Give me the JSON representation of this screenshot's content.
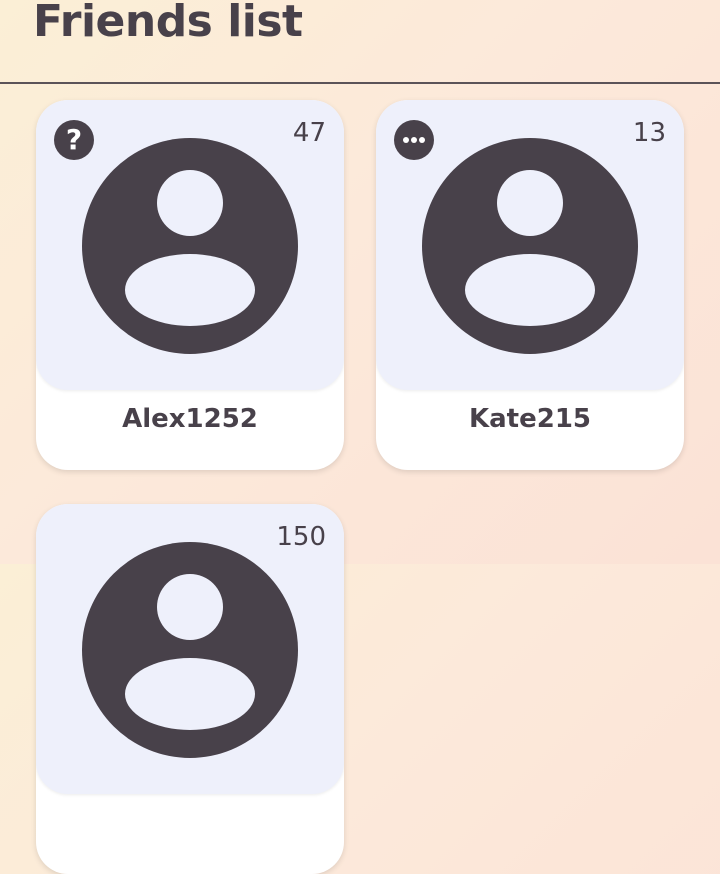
{
  "header": {
    "title": "Friends list"
  },
  "friends": [
    {
      "name": "Alex1252",
      "count": "47",
      "status_icon": "question-icon"
    },
    {
      "name": "Kate215",
      "count": "13",
      "status_icon": "more-dots-icon"
    },
    {
      "name": "",
      "count": "150",
      "status_icon": ""
    }
  ],
  "colors": {
    "accent_dark": "#48414a",
    "card_top": "#eef0fb",
    "card_bottom": "#ffffff"
  }
}
